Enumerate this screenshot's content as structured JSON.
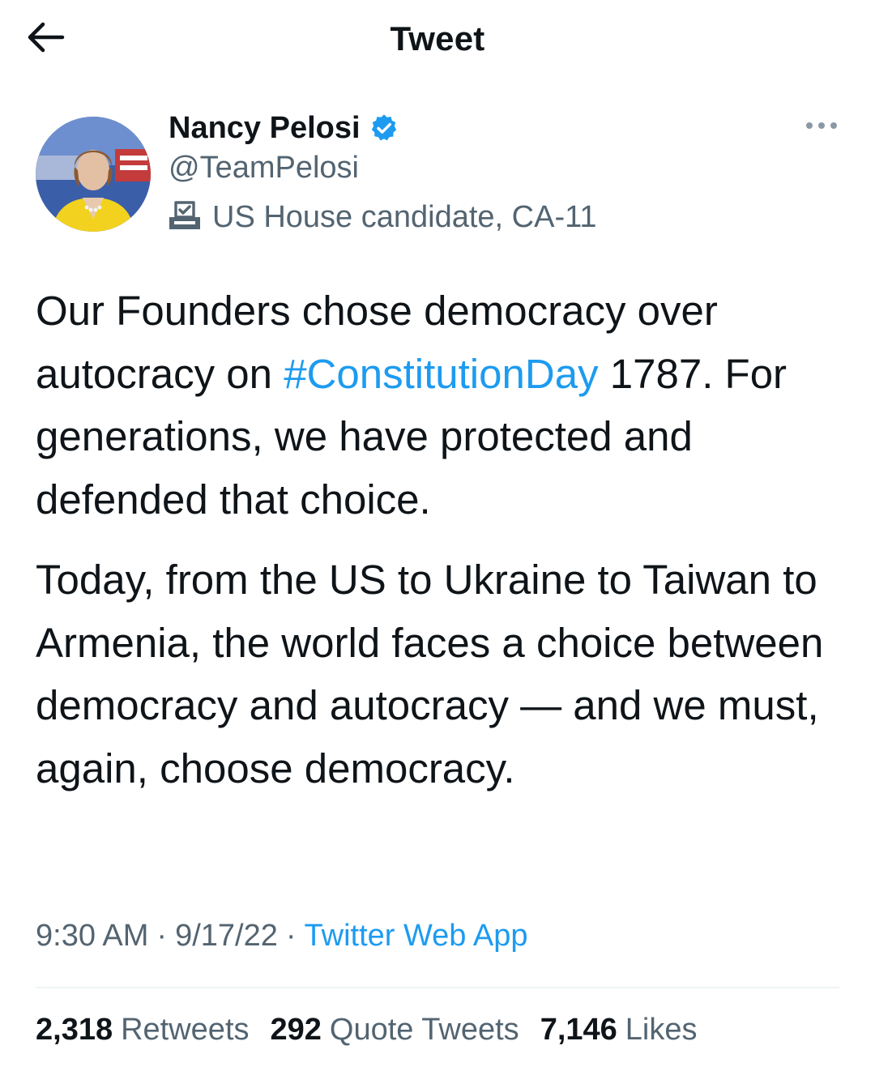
{
  "header": {
    "title": "Tweet",
    "back_icon": "arrow-left-icon"
  },
  "author": {
    "name": "Nancy Pelosi",
    "handle": "@TeamPelosi",
    "verified_icon": "verified-badge-icon",
    "label_icon": "ballot-box-icon",
    "label_text": "US House candidate, CA-11",
    "avatar": "profile-photo"
  },
  "menu": {
    "more_icon": "more-horizontal-icon"
  },
  "tweet": {
    "p1_before": "Our Founders chose democracy over autocracy on ",
    "p1_hashtag": "#ConstitutionDay",
    "p1_after": " 1787. For generations, we have protected and defended that choice.",
    "p2": "Today, from the US to Ukraine to Taiwan to Armenia, the world faces a choice between democracy and autocracy — and we must, again, choose democracy."
  },
  "meta": {
    "time": "9:30 AM",
    "sep1": "·",
    "date": "9/17/22",
    "sep2": "·",
    "source": "Twitter Web App"
  },
  "stats": {
    "retweets_count": "2,318",
    "retweets_label": "Retweets",
    "quotes_count": "292",
    "quotes_label": "Quote Tweets",
    "likes_count": "7,146",
    "likes_label": "Likes"
  },
  "colors": {
    "link": "#1d9bf0",
    "secondary_text": "#536471",
    "primary_text": "#0f1419"
  }
}
